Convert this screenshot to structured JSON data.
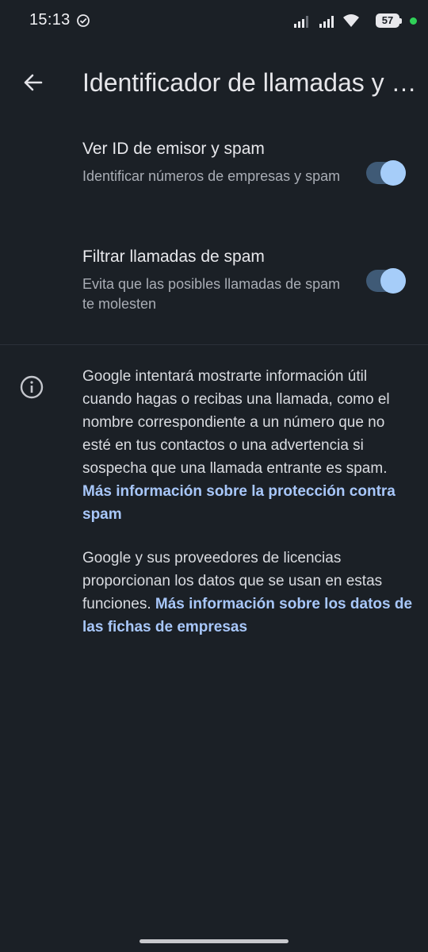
{
  "status_bar": {
    "time": "15:13",
    "battery": "57"
  },
  "header": {
    "title": "Identificador de llamadas y spam"
  },
  "settings": [
    {
      "title": "Ver ID de emisor y spam",
      "subtitle": "Identificar números de empresas y spam",
      "enabled": true
    },
    {
      "title": "Filtrar llamadas de spam",
      "subtitle": "Evita que las posibles llamadas de spam te molesten",
      "enabled": true
    }
  ],
  "info": {
    "paragraph_1": "Google intentará mostrarte información útil cuando hagas o recibas una llamada, como el nombre correspondiente a un número que no esté en tus contactos o una advertencia si sospecha que una llamada entrante es spam.",
    "link_1": "Más información sobre la protección contra spam",
    "paragraph_2": "Google y sus proveedores de licencias proporcionan los datos que se usan en estas funciones.",
    "link_2": "Más información sobre los datos de las fichas de empresas"
  },
  "colors": {
    "background": "#1b2026",
    "accent": "#a8c7fa",
    "switch_track": "#3f5a76",
    "switch_thumb": "#a6cdf9"
  },
  "icons": [
    "check-circle-icon",
    "signal-icon",
    "wifi-icon",
    "battery-icon",
    "back-arrow-icon",
    "info-icon"
  ]
}
